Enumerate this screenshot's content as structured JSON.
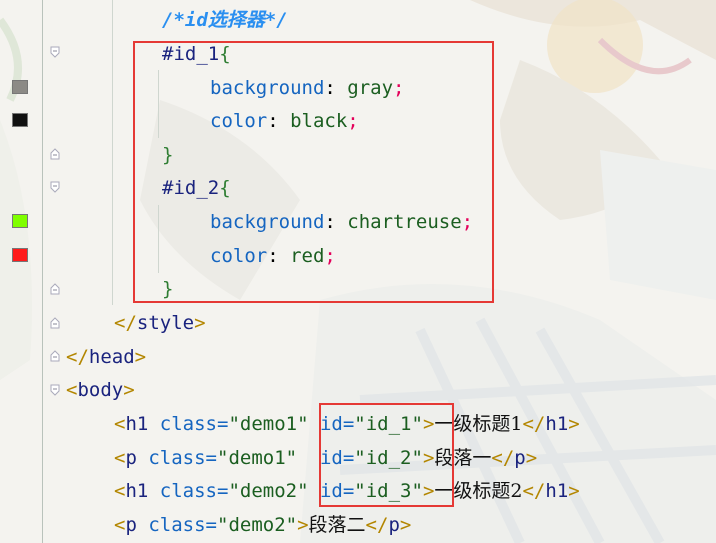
{
  "gutter": {
    "swatch_colors": [
      "#8c8a86",
      "#111111",
      "#7fff00",
      "#ff1a1a"
    ]
  },
  "editor": {
    "comment": "/*id选择器*/",
    "rule1": {
      "selector": "#id_1",
      "open": "{",
      "close": "}",
      "decls": [
        {
          "prop": "background",
          "sep": ": ",
          "val": "gray",
          "semi": ";"
        },
        {
          "prop": "color",
          "sep": ": ",
          "val": "black",
          "semi": ";"
        }
      ]
    },
    "rule2": {
      "selector": "#id_2",
      "open": "{",
      "close": "}",
      "decls": [
        {
          "prop": "background",
          "sep": ": ",
          "val": "chartreuse",
          "semi": ";"
        },
        {
          "prop": "color",
          "sep": ": ",
          "val": "red",
          "semi": ";"
        }
      ]
    },
    "style_close": {
      "open": "</",
      "name": "style",
      "end": ">"
    },
    "head_close": {
      "open": "</",
      "name": "head",
      "end": ">"
    },
    "body_open": {
      "open": "<",
      "name": "body",
      "end": ">"
    },
    "html_lines": [
      {
        "tag": "h1",
        "cls_attr": "class=",
        "cls": "\"demo1\"",
        "id_attr": "id=",
        "id": "\"id_1\"",
        "text": "一级标题1"
      },
      {
        "tag": "p",
        "cls_attr": "class=",
        "cls": "\"demo1\"",
        "id_attr": "id=",
        "id": "\"id_2\"",
        "text": "段落一"
      },
      {
        "tag": "h1",
        "cls_attr": "class=",
        "cls": "\"demo2\"",
        "id_attr": "id=",
        "id": "\"id_3\"",
        "text": "一级标题2"
      },
      {
        "tag": "p",
        "cls_attr": "class=",
        "cls": "\"demo2\"",
        "text": "段落二"
      }
    ]
  },
  "colors": {
    "highlight": "#e53935"
  }
}
